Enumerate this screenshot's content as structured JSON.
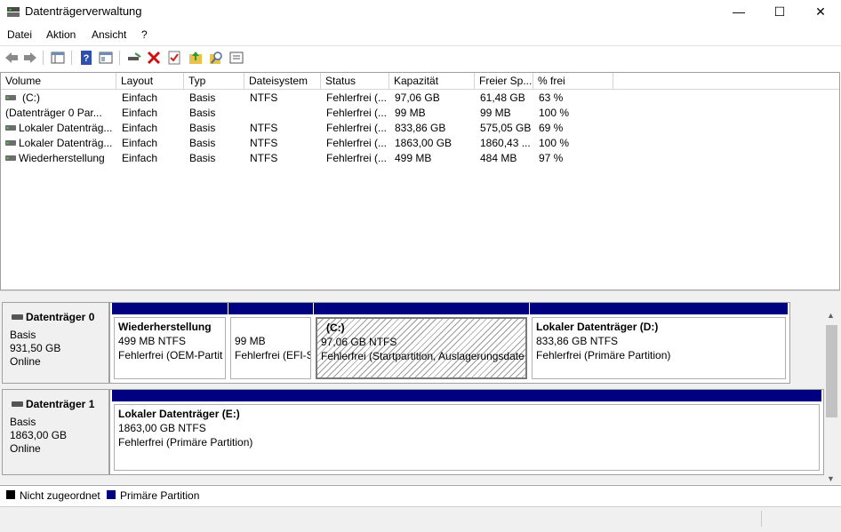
{
  "window": {
    "title": "Datenträgerverwaltung",
    "minimize": "—",
    "maximize": "☐",
    "close": "✕"
  },
  "menu": [
    "Datei",
    "Aktion",
    "Ansicht",
    "?"
  ],
  "toolbar": [
    "back-icon",
    "forward-icon",
    "console-tree-icon",
    "help-icon",
    "properties-icon",
    "connect-disk-icon",
    "delete-icon",
    "check-icon",
    "import-icon",
    "search-icon",
    "settings-list-icon"
  ],
  "volumes": {
    "columns": [
      "Volume",
      "Layout",
      "Typ",
      "Dateisystem",
      "Status",
      "Kapazität",
      "Freier Sp...",
      "% frei"
    ],
    "rows": [
      [
        "(C:)",
        "Einfach",
        "Basis",
        "NTFS",
        "Fehlerfrei (...",
        "97,06 GB",
        "61,48 GB",
        "63 %"
      ],
      [
        "(Datenträger 0 Par...",
        "Einfach",
        "Basis",
        "",
        "Fehlerfrei (...",
        "99 MB",
        "99 MB",
        "100 %"
      ],
      [
        "Lokaler Datenträg...",
        "Einfach",
        "Basis",
        "NTFS",
        "Fehlerfrei (...",
        "833,86 GB",
        "575,05 GB",
        "69 %"
      ],
      [
        "Lokaler Datenträg...",
        "Einfach",
        "Basis",
        "NTFS",
        "Fehlerfrei (...",
        "1863,00 GB",
        "1860,43 ...",
        "100 %"
      ],
      [
        "Wiederherstellung",
        "Einfach",
        "Basis",
        "NTFS",
        "Fehlerfrei (...",
        "499 MB",
        "484 MB",
        "97 %"
      ]
    ]
  },
  "disks": [
    {
      "name": "Datenträger 0",
      "type": "Basis",
      "size": "931,50 GB",
      "state": "Online",
      "partitions": [
        {
          "title": "Wiederherstellung",
          "size": "499 MB NTFS",
          "status": "Fehlerfrei (OEM-Partit"
        },
        {
          "title": "",
          "size": "99 MB",
          "status": "Fehlerfrei (EFI-S"
        },
        {
          "title": "(C:)",
          "size": "97,06 GB NTFS",
          "status": "Fehlerfrei (Startpartition, Auslagerungsdate"
        },
        {
          "title": "Lokaler Datenträger  (D:)",
          "size": "833,86 GB NTFS",
          "status": "Fehlerfrei (Primäre Partition)"
        }
      ]
    },
    {
      "name": "Datenträger 1",
      "type": "Basis",
      "size": "1863,00 GB",
      "state": "Online",
      "partitions": [
        {
          "title": "Lokaler Datenträger  (E:)",
          "size": "1863,00 GB NTFS",
          "status": "Fehlerfrei (Primäre Partition)"
        }
      ]
    }
  ],
  "legend": [
    {
      "label": "Nicht zugeordnet",
      "color": "#000000"
    },
    {
      "label": "Primäre Partition",
      "color": "#000080"
    }
  ]
}
